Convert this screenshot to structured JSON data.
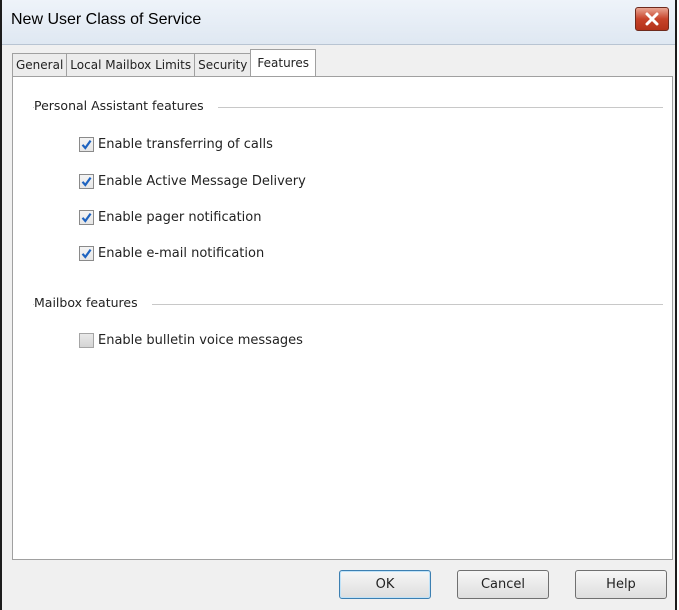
{
  "window": {
    "title": "New User Class of Service"
  },
  "tabs": [
    {
      "label": "General"
    },
    {
      "label": "Local Mailbox Limits"
    },
    {
      "label": "Security"
    },
    {
      "label": "Features"
    }
  ],
  "active_tab": "Features",
  "personal_assistant": {
    "heading": "Personal Assistant features",
    "options": [
      {
        "label": "Enable transferring of calls",
        "checked": true
      },
      {
        "label": "Enable Active Message Delivery",
        "checked": true
      },
      {
        "label": "Enable pager notification",
        "checked": true
      },
      {
        "label": "Enable e-mail notification",
        "checked": true
      }
    ]
  },
  "mailbox": {
    "heading": "Mailbox features",
    "options": [
      {
        "label": "Enable bulletin voice messages",
        "checked": false
      }
    ]
  },
  "buttons": {
    "ok": "OK",
    "cancel": "Cancel",
    "help": "Help"
  },
  "colors": {
    "check": "#1e63c0",
    "close_button": "#c7432a",
    "title_bar": "#dfe8f2"
  }
}
